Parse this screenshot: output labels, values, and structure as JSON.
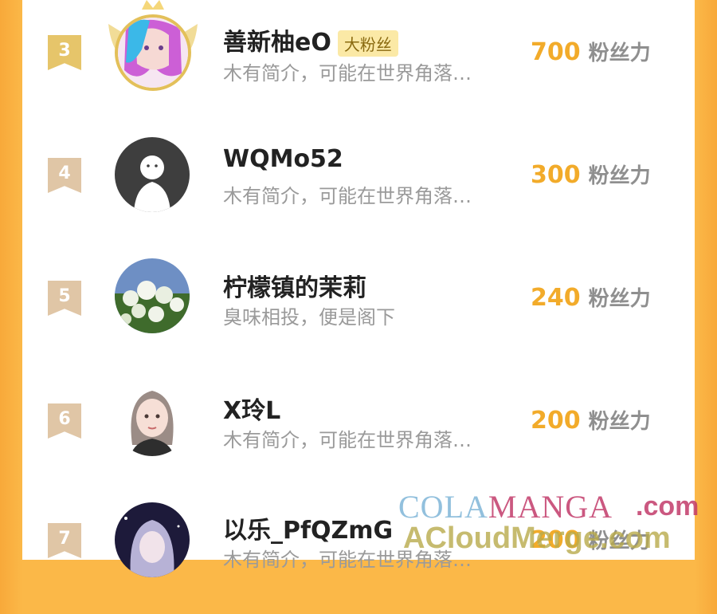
{
  "rows": [
    {
      "rank": "3",
      "name": "善新柚eO",
      "badge": "大粉丝",
      "bio": "木有简介，可能在世界角落…",
      "score": "700",
      "unit": "粉丝力"
    },
    {
      "rank": "4",
      "name": "WQMo52",
      "badge": "",
      "bio": "木有简介，可能在世界角落…",
      "score": "300",
      "unit": "粉丝力"
    },
    {
      "rank": "5",
      "name": "柠檬镇的茉莉",
      "badge": "",
      "bio": "臭味相投，便是阁下",
      "score": "240",
      "unit": "粉丝力"
    },
    {
      "rank": "6",
      "name": "X玲L",
      "badge": "",
      "bio": "木有简介，可能在世界角落…",
      "score": "200",
      "unit": "粉丝力"
    },
    {
      "rank": "7",
      "name": "以乐_PfQZmG",
      "badge": "",
      "bio": "木有简介，可能在世界角落…",
      "score": "200",
      "unit": "粉丝力"
    }
  ],
  "watermark": {
    "line1_a": "COLA",
    "line1_b": "MANGA",
    ".com": "",
    "line1_c": ".com",
    "line2": "ACloudMerge.com"
  },
  "colors": {
    "accent": "#f2ab2a",
    "background": "#fbb848",
    "badge": "#fbe9a6",
    "rank_gold": "#e6c56a",
    "rank_beige": "#e0c6a6"
  }
}
